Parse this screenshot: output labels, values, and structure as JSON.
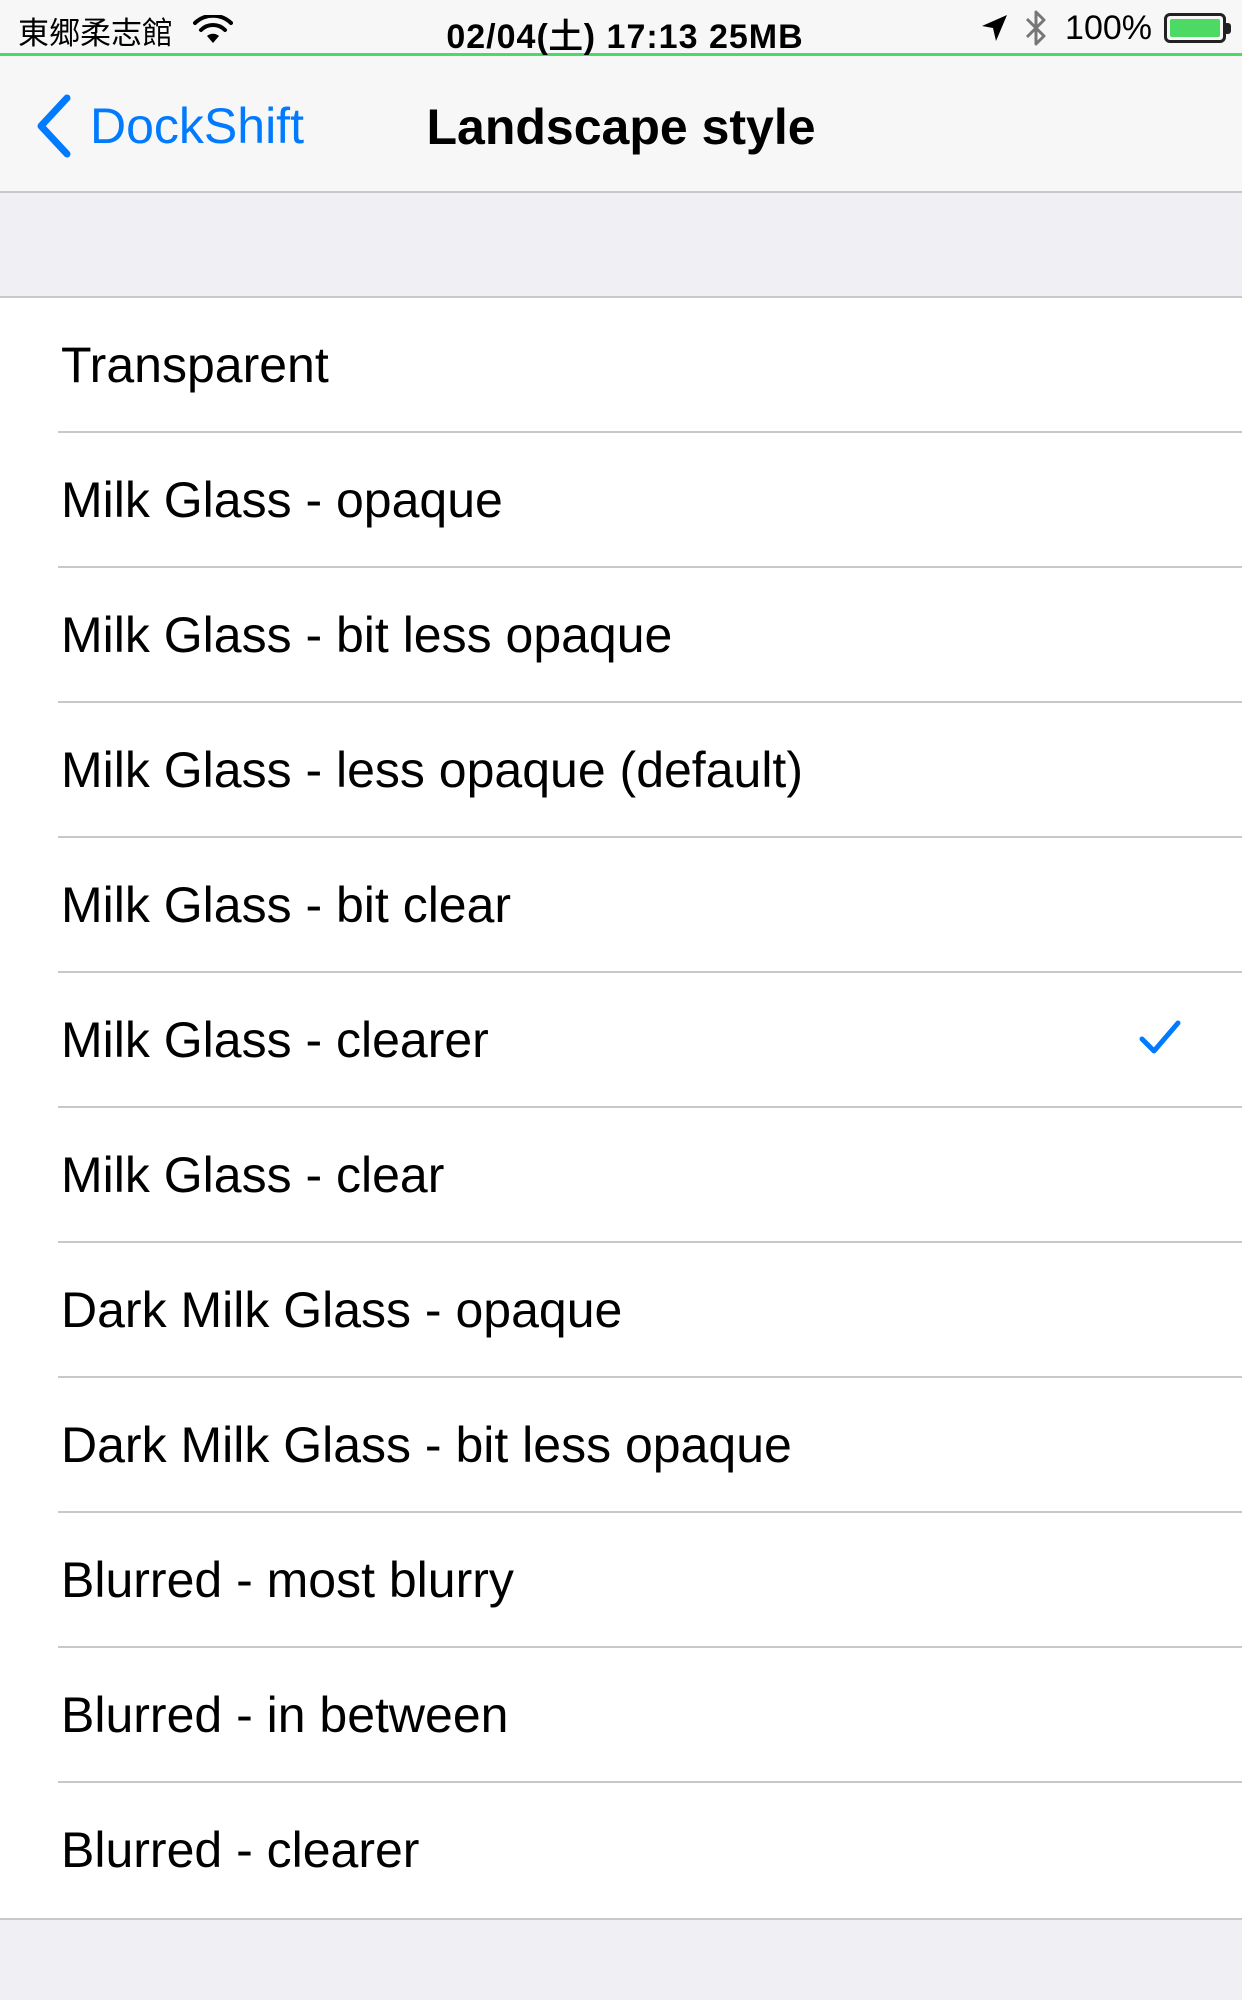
{
  "status_bar": {
    "carrier": "東郷柔志館",
    "center_text": "02/04(土) 17:13 25MB",
    "battery_percent": "100%",
    "battery_level": 1.0,
    "accent_color": "#4cd964"
  },
  "nav": {
    "back_label": "DockShift",
    "title": "Landscape style",
    "tint_color": "#007aff"
  },
  "options": [
    {
      "label": "Transparent",
      "selected": false
    },
    {
      "label": "Milk Glass - opaque",
      "selected": false
    },
    {
      "label": "Milk Glass - bit less opaque",
      "selected": false
    },
    {
      "label": "Milk Glass - less opaque (default)",
      "selected": false
    },
    {
      "label": "Milk Glass - bit clear",
      "selected": false
    },
    {
      "label": "Milk Glass - clearer",
      "selected": true
    },
    {
      "label": "Milk Glass - clear",
      "selected": false
    },
    {
      "label": "Dark Milk Glass - opaque",
      "selected": false
    },
    {
      "label": "Dark Milk Glass - bit less opaque",
      "selected": false
    },
    {
      "label": "Blurred - most blurry",
      "selected": false
    },
    {
      "label": "Blurred - in between",
      "selected": false
    },
    {
      "label": "Blurred - clearer",
      "selected": false
    }
  ],
  "icons": {
    "wifi": "wifi-icon",
    "location": "location-arrow-icon",
    "bluetooth": "bluetooth-icon",
    "battery": "battery-icon",
    "back": "chevron-left-icon",
    "checkmark": "checkmark-icon"
  }
}
